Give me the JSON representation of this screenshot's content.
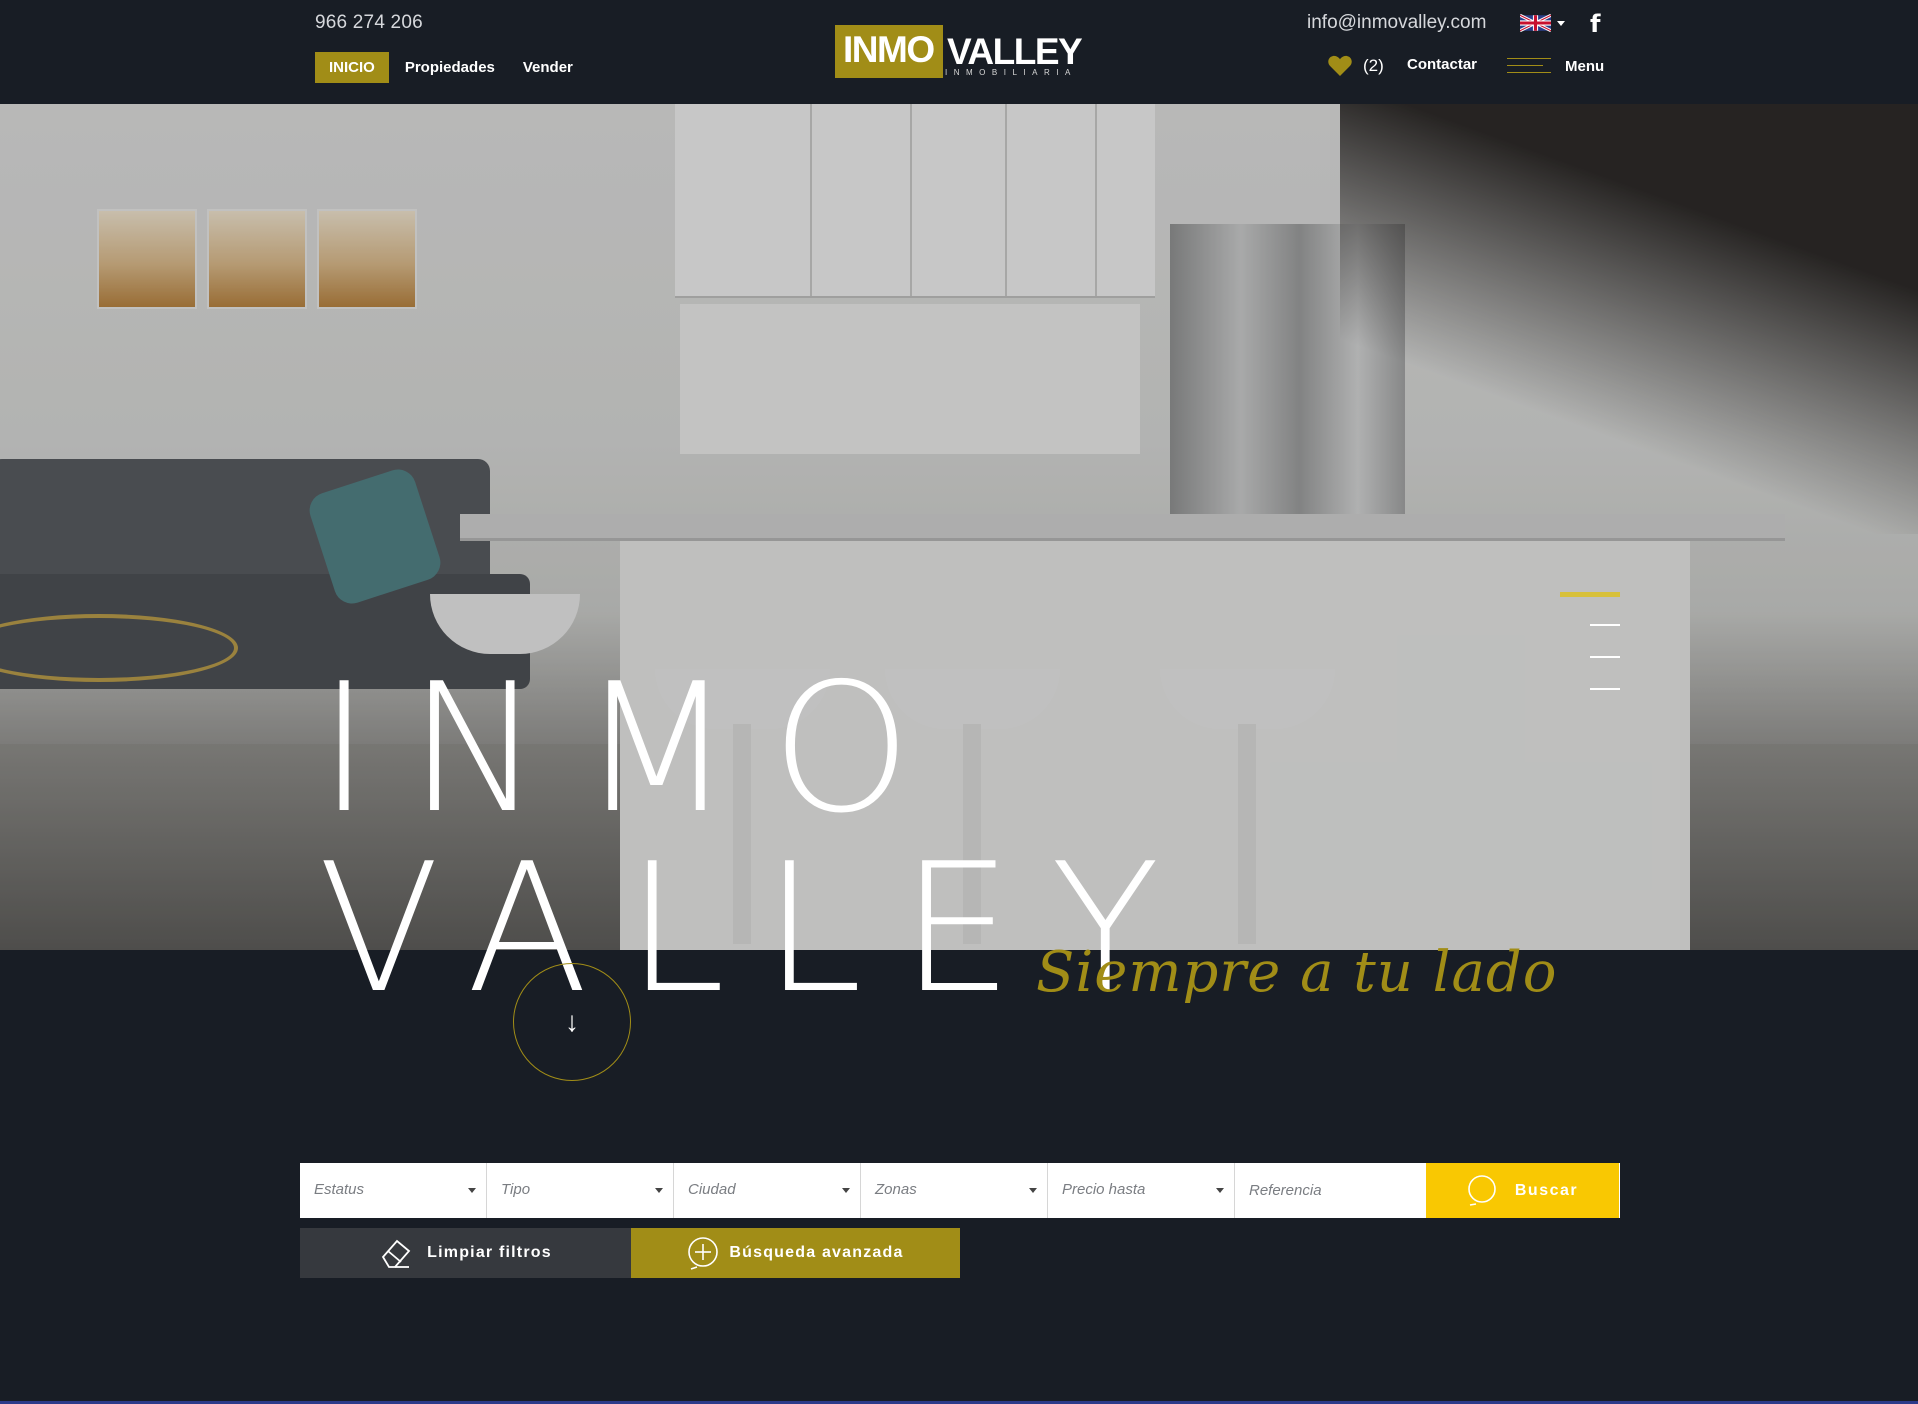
{
  "header": {
    "phone": "966 274 206",
    "email": "info@inmovalley.com",
    "nav": [
      {
        "label": "INICIO",
        "active": true
      },
      {
        "label": "Propiedades",
        "active": false
      },
      {
        "label": "Vender",
        "active": false
      }
    ],
    "logo": {
      "part1": "INMO",
      "part2": "VALLEY",
      "subtitle": "INMOBILIARIA"
    },
    "language_flag_icon": "uk-flag-icon",
    "facebook_icon": "f",
    "favorites_count": "(2)",
    "contact_label": "Contactar",
    "menu_label": "Menu"
  },
  "hero": {
    "title_line1": "INMO",
    "title_line2": "VALLEY",
    "tagline": "Siempre a tu lado",
    "scroll_icon": "↓"
  },
  "search": {
    "fields": [
      {
        "label": "Estatus"
      },
      {
        "label": "Tipo"
      },
      {
        "label": "Ciudad"
      },
      {
        "label": "Zonas"
      },
      {
        "label": "Precio hasta"
      }
    ],
    "reference_placeholder": "Referencia",
    "search_label": "Buscar",
    "clear_label": "Limpiar filtros",
    "advanced_label": "Búsqueda avanzada"
  },
  "colors": {
    "background": "#181d25",
    "accent_gold": "#a18d17",
    "search_yellow": "#f9c802",
    "clear_button": "#36393e"
  }
}
